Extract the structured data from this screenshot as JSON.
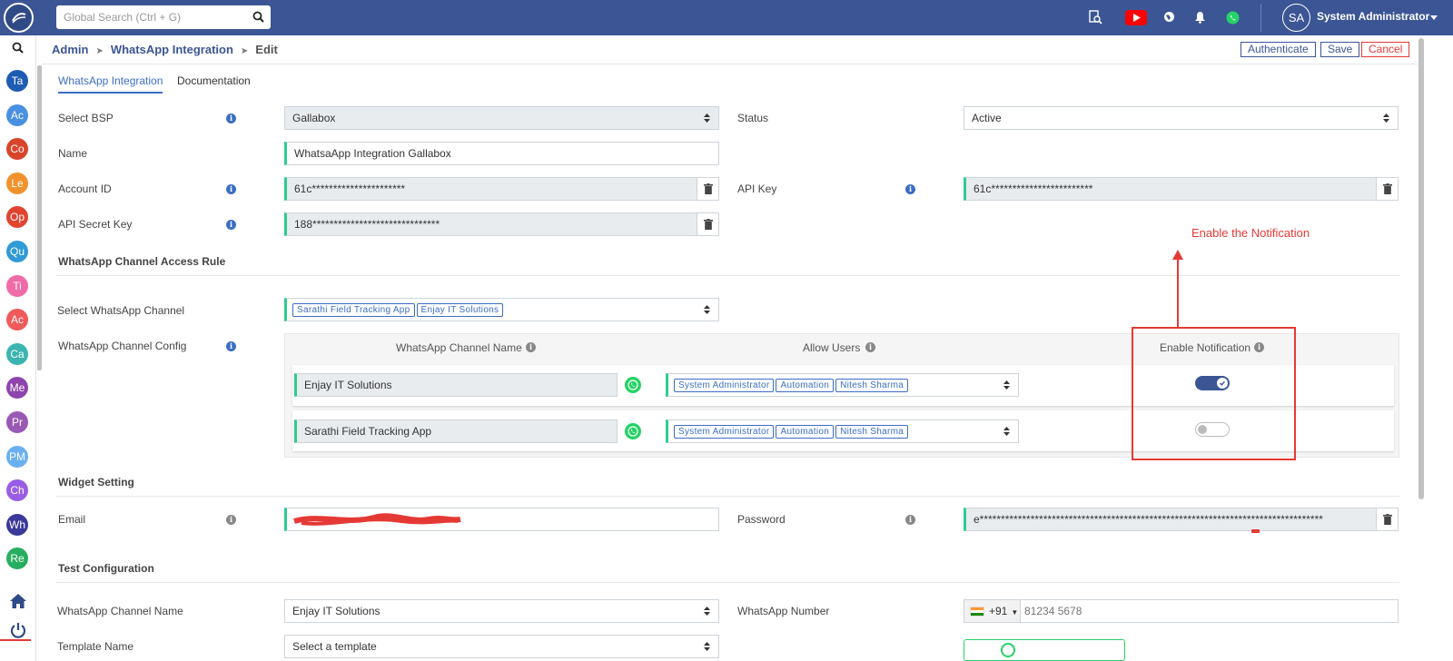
{
  "topbar": {
    "search_placeholder": "Global Search (Ctrl + G)",
    "user_initials": "SA",
    "user_name": "System Administrator",
    "icons": [
      "search-doc-icon",
      "youtube-icon",
      "globe-icon",
      "bell-icon",
      "whatsapp-icon"
    ]
  },
  "sidebar": {
    "modules": [
      {
        "label": "Ta",
        "color": "#1e5cb3"
      },
      {
        "label": "Ac",
        "color": "#4a90e2"
      },
      {
        "label": "Co",
        "color": "#d9452b"
      },
      {
        "label": "Le",
        "color": "#f0922b"
      },
      {
        "label": "Op",
        "color": "#e0442f"
      },
      {
        "label": "Qu",
        "color": "#2f9ad6"
      },
      {
        "label": "Ti",
        "color": "#f06ba8"
      },
      {
        "label": "Ac",
        "color": "#f05a5a"
      },
      {
        "label": "Ca",
        "color": "#3cb5b0"
      },
      {
        "label": "Me",
        "color": "#8e44ad"
      },
      {
        "label": "Pr",
        "color": "#9b59b6"
      },
      {
        "label": "PM",
        "color": "#6ab0f0"
      },
      {
        "label": "Ch",
        "color": "#9b5de5"
      },
      {
        "label": "Wh",
        "color": "#3b3a9a"
      },
      {
        "label": "Re",
        "color": "#27ae60"
      }
    ]
  },
  "breadcrumb": {
    "items": [
      "Admin",
      "WhatsApp Integration"
    ],
    "current": "Edit"
  },
  "actions": {
    "authenticate": "Authenticate",
    "save": "Save",
    "cancel": "Cancel"
  },
  "tabs": [
    "WhatsApp Integration",
    "Documentation"
  ],
  "form": {
    "select_bsp": {
      "label": "Select BSP",
      "value": "Gallabox"
    },
    "status": {
      "label": "Status",
      "value": "Active"
    },
    "name": {
      "label": "Name",
      "value": "WhatsaApp Integration Gallabox"
    },
    "account_id": {
      "label": "Account ID",
      "value": "61c**********************"
    },
    "api_key": {
      "label": "API Key",
      "value": "61c************************"
    },
    "api_secret": {
      "label": "API Secret Key",
      "value": "188******************************"
    }
  },
  "access_rule": {
    "title": "WhatsApp Channel Access Rule",
    "select_channel_label": "Select WhatsApp Channel",
    "selected_channels": [
      "Sarathi Field Tracking App",
      "Enjay IT Solutions"
    ],
    "config_label": "WhatsApp Channel Config",
    "headers": {
      "channel_name": "WhatsApp Channel Name",
      "allow_users": "Allow Users",
      "enable_notification": "Enable Notification"
    },
    "rows": [
      {
        "channel": "Enjay IT Solutions",
        "users": [
          "System Administrator",
          "Automation",
          "Nitesh Sharma"
        ],
        "notification": true
      },
      {
        "channel": "Sarathi Field Tracking App",
        "users": [
          "System Administrator",
          "Automation",
          "Nitesh Sharma"
        ],
        "notification": false
      }
    ]
  },
  "annotation": {
    "text": "Enable the Notification",
    "color": "#e53935"
  },
  "widget": {
    "title": "Widget Setting",
    "email_label": "Email",
    "password_label": "Password",
    "password_value": "e*********************************************************************************"
  },
  "test": {
    "title": "Test Configuration",
    "channel_label": "WhatsApp Channel Name",
    "channel_value": "Enjay IT Solutions",
    "number_label": "WhatsApp Number",
    "country_code": "+91",
    "number_placeholder": "81234 5678",
    "template_label": "Template Name",
    "template_value": "Select a template"
  }
}
